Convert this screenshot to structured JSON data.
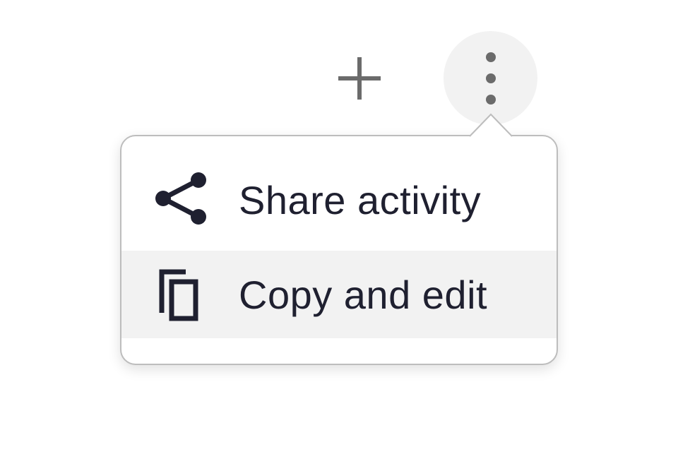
{
  "toolbar": {
    "add_icon": "plus-icon",
    "more_icon": "more-vertical-icon"
  },
  "menu": {
    "items": [
      {
        "label": "Share activity",
        "icon": "share-icon",
        "highlighted": false
      },
      {
        "label": "Copy and edit",
        "icon": "copy-icon",
        "highlighted": true
      }
    ]
  },
  "colors": {
    "text": "#1f2030",
    "icon_gray": "#6b6b6b",
    "hover_bg": "#f2f2f2",
    "menu_border": "#bdbdbd"
  }
}
